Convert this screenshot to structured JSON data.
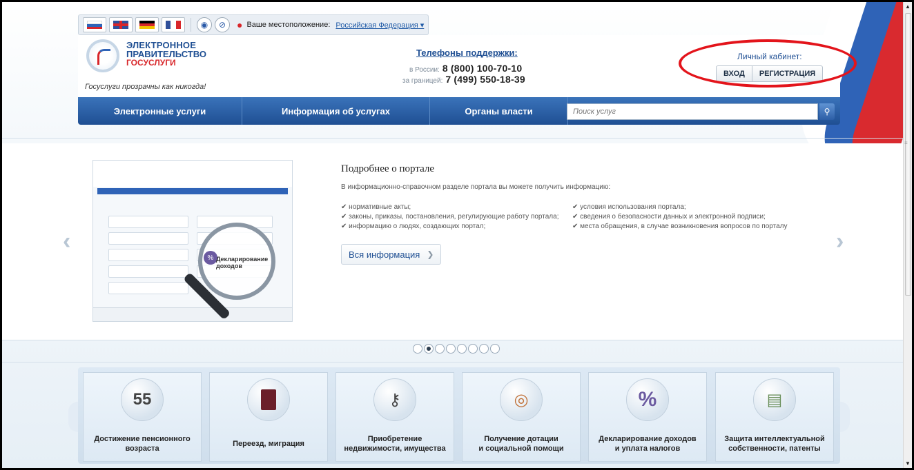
{
  "toolbar": {
    "languages": [
      {
        "name": "ru-flag-icon",
        "colors": [
          "#ffffff",
          "#2f63b7",
          "#d8262a"
        ]
      },
      {
        "name": "uk-flag-icon",
        "colors": [
          "#2f4f9a",
          "#ffffff",
          "#d8262a"
        ]
      },
      {
        "name": "de-flag-icon",
        "colors": [
          "#000000",
          "#d8262a",
          "#f2c300"
        ]
      },
      {
        "name": "fr-flag-icon",
        "colors": [
          "#2f4f9a",
          "#ffffff",
          "#d8262a"
        ]
      }
    ],
    "location_label": "Ваше местоположение:",
    "location_value": "Российская Федерация"
  },
  "header": {
    "logo_line1": "ЭЛЕКТРОННОЕ",
    "logo_line2": "ПРАВИТЕЛЬСТВО",
    "logo_line3": "ГОСУСЛУГИ",
    "slogan": "Госуслуги прозрачны как никогда!",
    "support_title": "Телефоны поддержки",
    "phones": [
      {
        "label": "в России:",
        "number": "8 (800) 100-70-10"
      },
      {
        "label": "за границей:",
        "number": "7 (499) 550-18-39"
      }
    ],
    "cabinet_title": "Личный кабинет:",
    "login_label": "ВХОД",
    "register_label": "РЕГИСТРАЦИЯ"
  },
  "nav": {
    "items": [
      "Электронные услуги",
      "Информация об услугах",
      "Органы власти"
    ],
    "search_placeholder": "Поиск услуг"
  },
  "slide": {
    "title": "Подробнее о портале",
    "intro": "В информационно-справочном разделе портала вы можете получить информацию:",
    "bullets_left": [
      "нормативные акты;",
      "законы, приказы, постановления, регулирующие работу портала;",
      "информацию о людях, создающих портал;"
    ],
    "bullets_right": [
      "условия использования портала;",
      "сведения о безопасности данных и электронной подписи;",
      "места обращения, в случае возникновения вопросов по порталу"
    ],
    "button_label": "Вся информация",
    "preview_magnified_text": "Декларирование доходов",
    "dots_total": 8,
    "dots_active": 2
  },
  "services": [
    {
      "line1": "Достижение пенсионного",
      "line2": "возраста",
      "icon": "calendar-55-icon",
      "glyph": "55"
    },
    {
      "line1": "Переезд, миграция",
      "line2": "",
      "icon": "passport-icon",
      "glyph": "▮"
    },
    {
      "line1": "Приобретение",
      "line2": "недвижимости, имущества",
      "icon": "keys-icon",
      "glyph": "⚷"
    },
    {
      "line1": "Получение дотации",
      "line2": "и социальной помощи",
      "icon": "lifebuoy-icon",
      "glyph": "◎"
    },
    {
      "line1": "Декларирование доходов",
      "line2": "и уплата налогов",
      "icon": "percent-icon",
      "glyph": "%"
    },
    {
      "line1": "Защита интеллектуальной",
      "line2": "собственности, патенты",
      "icon": "certificate-icon",
      "glyph": "▤"
    }
  ]
}
